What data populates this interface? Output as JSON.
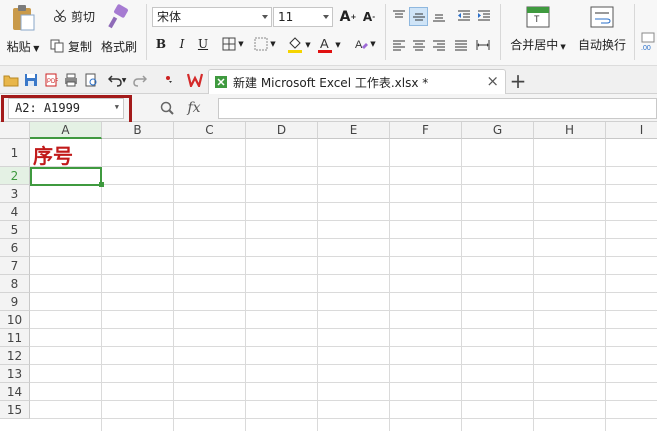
{
  "ribbon": {
    "paste_label": "粘贴",
    "cut_label": "剪切",
    "copy_label": "复制",
    "format_painter_label": "格式刷",
    "font_name": "宋体",
    "font_size": "11",
    "merge_center_label": "合并居中",
    "wrap_text_label": "自动换行"
  },
  "tabbar": {
    "doc_tab_title": "新建 Microsoft Excel 工作表.xlsx *",
    "close_glyph": "×",
    "new_tab_glyph": "+"
  },
  "formula_bar": {
    "name_box": "A2: A1999",
    "fx_label": "fx",
    "formula_value": ""
  },
  "grid": {
    "columns": [
      "A",
      "B",
      "C",
      "D",
      "E",
      "F",
      "G",
      "H",
      "I"
    ],
    "rows": [
      "1",
      "2",
      "3",
      "4",
      "5",
      "6",
      "7",
      "8",
      "9",
      "10",
      "11",
      "12",
      "13",
      "14",
      "15"
    ],
    "cell_A1": "序号",
    "active_row": "2",
    "active_col": "A"
  },
  "colors": {
    "accent_green": "#3f9a3f",
    "highlight_red": "#a31a1a",
    "cell_text_red": "#c11a1a",
    "ribbon_bg": "#f7f7f7"
  }
}
